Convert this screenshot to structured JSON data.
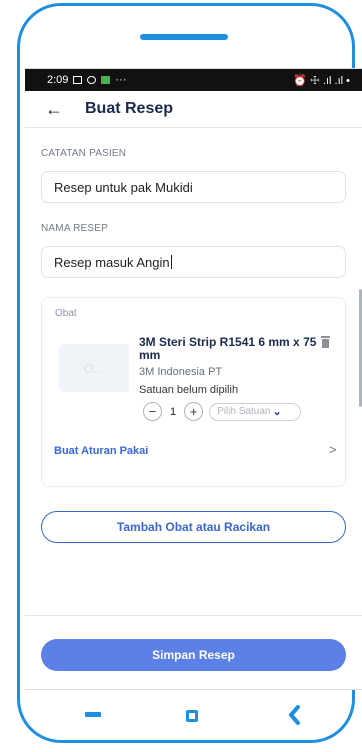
{
  "status_bar": {
    "time": "2:09",
    "more": "···",
    "right_icons": "⏰ ☩ .ıl .ıl •"
  },
  "header": {
    "back_icon": "arrow-left-icon",
    "title": "Buat Resep"
  },
  "form": {
    "catatan_label": "CATATAN PASIEN",
    "catatan_value": "Resep untuk pak Mukidi",
    "nama_label": "NAMA RESEP",
    "nama_value": "Resep masuk Angin"
  },
  "obat_card": {
    "label": "Obat",
    "thumbnail_text": "O...",
    "product_name": "3M Steri Strip R1541 6 mm x 75 mm",
    "brand": "3M Indonesia PT",
    "satuan_status": "Satuan belum dipilih",
    "quantity": "1",
    "minus": "−",
    "plus": "+",
    "satuan_placeholder": "Pilih Satuan",
    "aturan_link": "Buat Aturan Pakai",
    "aturan_chevron": ">"
  },
  "buttons": {
    "tambah": "Tambah Obat atau Racikan",
    "simpan": "Simpan Resep"
  },
  "colors": {
    "frame": "#1e8fe0",
    "primary": "#5b80e6",
    "link": "#3868d8"
  }
}
